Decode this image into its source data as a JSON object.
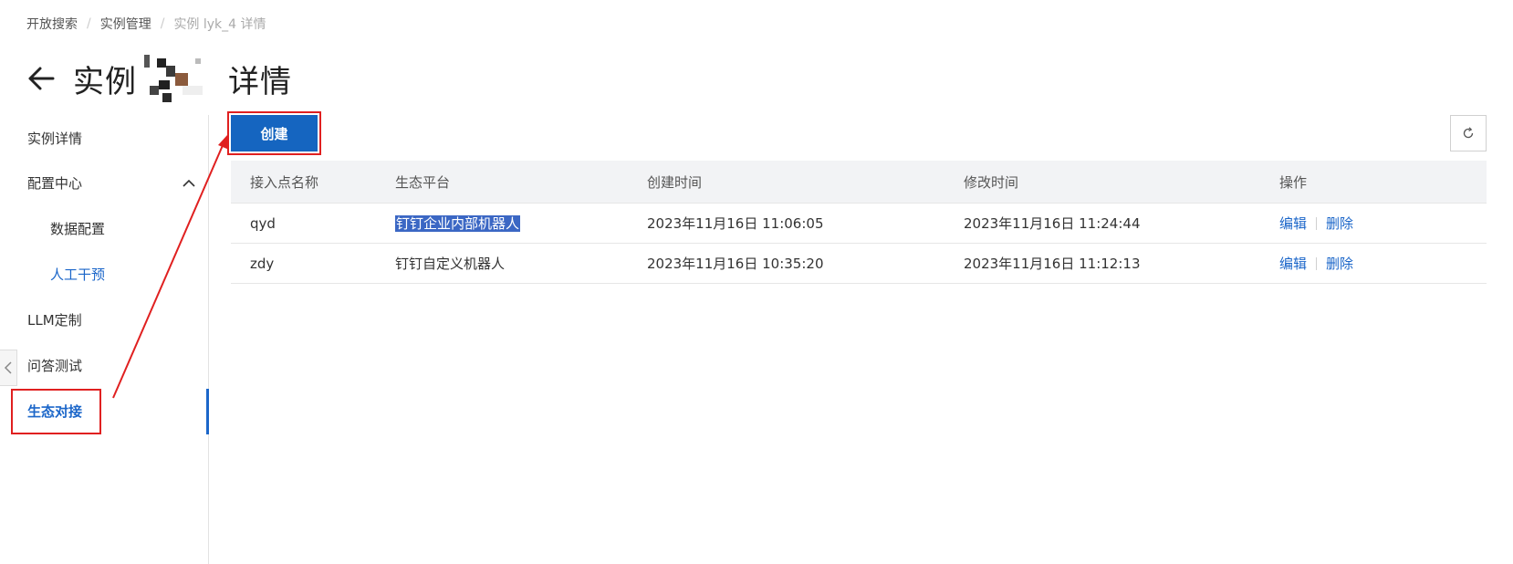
{
  "breadcrumb": {
    "items": [
      "开放搜索",
      "实例管理"
    ],
    "current": "实例 lyk_4 详情"
  },
  "header": {
    "title_prefix": "实例",
    "title_suffix": "详情"
  },
  "sidebar": {
    "items": [
      {
        "label": "实例详情"
      },
      {
        "label": "配置中心"
      },
      {
        "label": "数据配置"
      },
      {
        "label": "人工干预"
      },
      {
        "label": "LLM定制"
      },
      {
        "label": "问答测试"
      },
      {
        "label": "生态对接"
      }
    ]
  },
  "toolbar": {
    "create_label": "创建"
  },
  "table": {
    "columns": [
      "接入点名称",
      "生态平台",
      "创建时间",
      "修改时间",
      "操作"
    ],
    "rows": [
      {
        "name": "qyd",
        "platform": "钉钉企业内部机器人",
        "created": "2023年11月16日 11:06:05",
        "modified": "2023年11月16日 11:24:44",
        "edit": "编辑",
        "delete": "删除"
      },
      {
        "name": "zdy",
        "platform": "钉钉自定义机器人",
        "created": "2023年11月16日 10:35:20",
        "modified": "2023年11月16日 11:12:13",
        "edit": "编辑",
        "delete": "删除"
      }
    ]
  },
  "colors": {
    "primary": "#1565c0",
    "link": "#1b66c9",
    "annotation": "#e02020",
    "selection": "#3b67c4"
  },
  "icons": {
    "back": "arrow-left-icon",
    "refresh": "refresh-icon",
    "expand": "chevron-up-icon",
    "collapse": "chevron-left-icon"
  }
}
